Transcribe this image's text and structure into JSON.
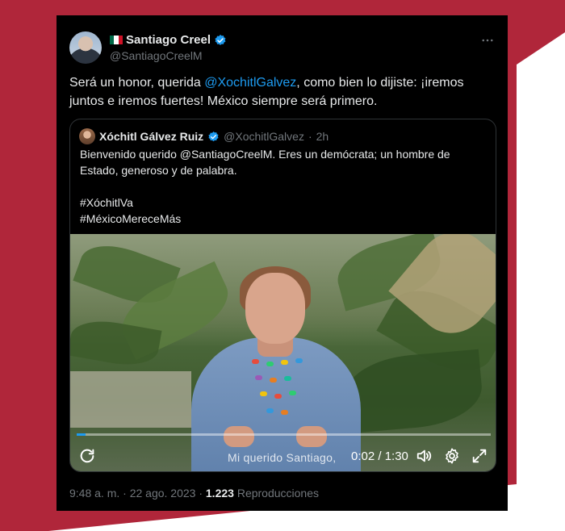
{
  "author": {
    "name": "Santiago Creel",
    "handle": "@SantiagoCreelM",
    "flag_colors": [
      "#006847",
      "#ffffff",
      "#ce1126"
    ]
  },
  "tweet": {
    "text_before": "Será un honor, querida ",
    "mention": "@XochitlGalvez",
    "text_after": ", como bien lo dijiste: ¡iremos juntos e iremos fuertes! México siempre será primero."
  },
  "quote": {
    "name": "Xóchitl Gálvez Ruiz",
    "handle": "@XochitlGalvez",
    "separator": "·",
    "age": "2h",
    "line1": "Bienvenido querido @SantiagoCreelM. Eres un demócrata; un hombre de Estado, generoso y de palabra.",
    "hashtag1": "#XóchitlVa",
    "hashtag2": "#MéxicoMereceMás"
  },
  "video": {
    "caption": "Mi querido Santiago,",
    "time": "0:02 / 1:30",
    "progress_fraction": 0.022
  },
  "footer": {
    "timestamp": "9:48 a. m. · 22 ago. 2023 · ",
    "views_count": "1.223",
    "views_label": " Reproducciones"
  },
  "colors": {
    "accent": "#1d9bf0",
    "brand_bg": "#b0263a",
    "card_bg": "#000000"
  },
  "icons": {
    "verified": "verified-badge-icon",
    "more": "more-options-icon",
    "replay": "replay-icon",
    "volume": "volume-icon",
    "settings": "settings-gear-icon",
    "fullscreen": "fullscreen-icon"
  }
}
